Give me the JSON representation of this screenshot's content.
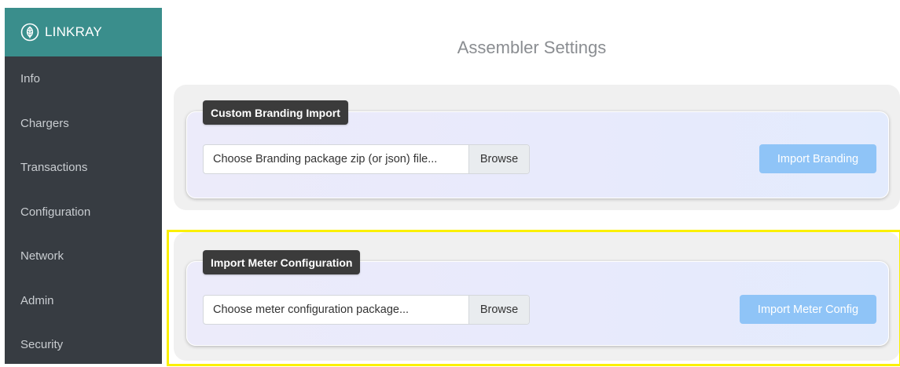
{
  "brand": {
    "name": "LINKRAY",
    "icon": "leaf-logo-icon"
  },
  "sidebar": {
    "items": [
      {
        "label": "Info"
      },
      {
        "label": "Chargers"
      },
      {
        "label": "Transactions"
      },
      {
        "label": "Configuration"
      },
      {
        "label": "Network"
      },
      {
        "label": "Admin"
      },
      {
        "label": "Security"
      }
    ]
  },
  "page": {
    "title": "Assembler Settings"
  },
  "sections": [
    {
      "title": "Custom Branding Import",
      "file_placeholder": "Choose Branding package zip (or json) file...",
      "browse_label": "Browse",
      "action_label": "Import Branding"
    },
    {
      "title": "Import Meter Configuration",
      "file_placeholder": "Choose meter configuration package...",
      "browse_label": "Browse",
      "action_label": "Import Meter Config"
    }
  ],
  "colors": {
    "sidebar_bg": "#373c42",
    "brand_bg": "#3a8e8c",
    "button_primary_disabled": "#8fc4f7",
    "highlight": "#fbf000"
  }
}
